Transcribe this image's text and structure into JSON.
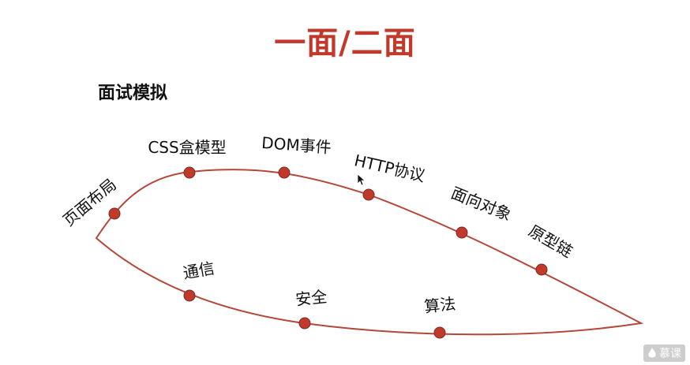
{
  "slide": {
    "title": "一面/二面",
    "subtitle": "面试模拟"
  },
  "colors": {
    "accent": "#c0392b",
    "curve": "#b5473a",
    "node_fill": "#c0392b",
    "text": "#111111"
  },
  "diagram": {
    "upper_nodes": [
      {
        "label": "页面布局"
      },
      {
        "label": "CSS盒模型"
      },
      {
        "label": "DOM事件"
      },
      {
        "label": "HTTP协议"
      },
      {
        "label": "面向对象"
      },
      {
        "label": "原型链"
      }
    ],
    "lower_nodes": [
      {
        "label": "通信"
      },
      {
        "label": "安全"
      },
      {
        "label": "算法"
      }
    ]
  },
  "watermark": {
    "icon": "flame-logo-icon",
    "text": "慕课"
  },
  "cursor": {
    "icon": "mouse-cursor-icon"
  }
}
